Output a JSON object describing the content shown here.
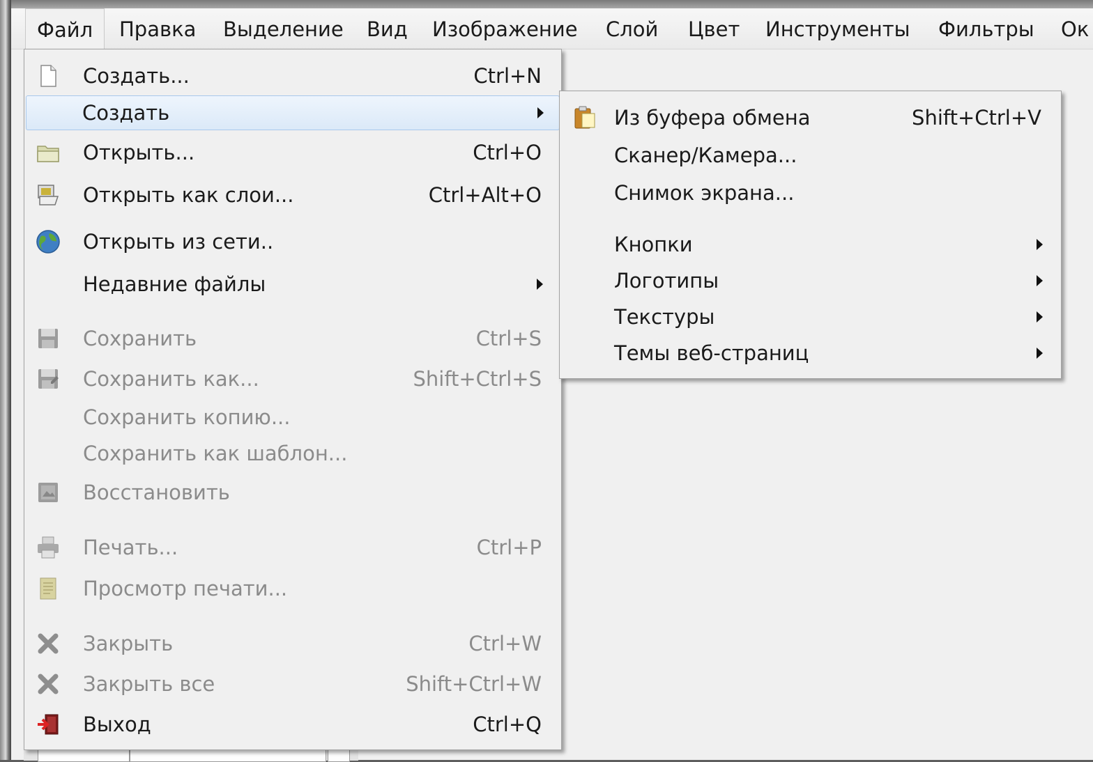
{
  "menubar": {
    "items": [
      "Файл",
      "Правка",
      "Выделение",
      "Вид",
      "Изображение",
      "Слой",
      "Цвет",
      "Инструменты",
      "Фильтры",
      "Ок"
    ]
  },
  "file_menu": {
    "items": [
      {
        "label": "Создать...",
        "shortcut": "Ctrl+N",
        "icon": "new-document-icon",
        "state": "enabled"
      },
      {
        "label": "Создать",
        "shortcut": "",
        "icon": "",
        "state": "highlighted",
        "submenu": true
      },
      {
        "label": "Открыть...",
        "shortcut": "Ctrl+O",
        "icon": "open-folder-icon",
        "state": "enabled"
      },
      {
        "label": "Открыть как слои...",
        "shortcut": "Ctrl+Alt+O",
        "icon": "open-as-layers-icon",
        "state": "enabled"
      },
      {
        "label": "Открыть из сети..",
        "shortcut": "",
        "icon": "globe-icon",
        "state": "enabled"
      },
      {
        "label": "Недавние файлы",
        "shortcut": "",
        "icon": "",
        "state": "enabled",
        "submenu": true
      },
      {
        "label": "Сохранить",
        "shortcut": "Ctrl+S",
        "icon": "save-icon",
        "state": "disabled"
      },
      {
        "label": "Сохранить как...",
        "shortcut": "Shift+Ctrl+S",
        "icon": "save-as-icon",
        "state": "disabled"
      },
      {
        "label": "Сохранить копию...",
        "shortcut": "",
        "icon": "",
        "state": "disabled"
      },
      {
        "label": "Сохранить как шаблон...",
        "shortcut": "",
        "icon": "",
        "state": "disabled"
      },
      {
        "label": "Восстановить",
        "shortcut": "",
        "icon": "revert-icon",
        "state": "disabled"
      },
      {
        "label": "Печать...",
        "shortcut": "Ctrl+P",
        "icon": "printer-icon",
        "state": "disabled"
      },
      {
        "label": "Просмотр печати...",
        "shortcut": "",
        "icon": "print-preview-icon",
        "state": "disabled"
      },
      {
        "label": "Закрыть",
        "shortcut": "Ctrl+W",
        "icon": "close-icon",
        "state": "disabled"
      },
      {
        "label": "Закрыть все",
        "shortcut": "Shift+Ctrl+W",
        "icon": "close-all-icon",
        "state": "disabled"
      },
      {
        "label": "Выход",
        "shortcut": "Ctrl+Q",
        "icon": "exit-icon",
        "state": "enabled"
      }
    ]
  },
  "create_submenu": {
    "items": [
      {
        "label": "Из буфера обмена",
        "shortcut": "Shift+Ctrl+V",
        "icon": "paste-icon",
        "submenu": false
      },
      {
        "label": "Сканер/Камера...",
        "shortcut": "",
        "icon": "",
        "submenu": false
      },
      {
        "label": "Снимок экрана...",
        "shortcut": "",
        "icon": "",
        "submenu": false
      },
      {
        "label": "Кнопки",
        "shortcut": "",
        "icon": "",
        "submenu": true
      },
      {
        "label": "Логотипы",
        "shortcut": "",
        "icon": "",
        "submenu": true
      },
      {
        "label": "Текстуры",
        "shortcut": "",
        "icon": "",
        "submenu": true
      },
      {
        "label": "Темы веб-страниц",
        "shortcut": "",
        "icon": "",
        "submenu": true
      }
    ]
  },
  "colors": {
    "menu_bg": "#f0f0f0",
    "highlight": "#dbe9f8",
    "disabled_text": "#8b8b8b"
  }
}
